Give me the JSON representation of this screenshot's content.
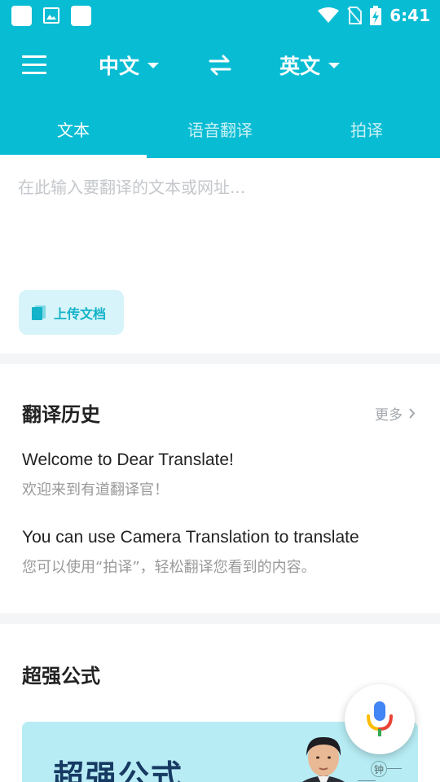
{
  "status_bar": {
    "time": "6:41"
  },
  "app_bar": {
    "source_lang": "中文",
    "target_lang": "英文"
  },
  "tabs": [
    {
      "label": "文本",
      "active": true
    },
    {
      "label": "语音翻译",
      "active": false
    },
    {
      "label": "拍译",
      "active": false
    }
  ],
  "input": {
    "placeholder": "在此输入要翻译的文本或网址...",
    "value": "",
    "upload_label": "上传文档"
  },
  "history": {
    "title": "翻译历史",
    "more_label": "更多",
    "items": [
      {
        "source": "Welcome to Dear Translate!",
        "translation": "欢迎来到有道翻译官！"
      },
      {
        "source": "You can use Camera Translation to translate",
        "translation": "您可以使用“拍译”，轻松翻译您看到的内容。"
      }
    ]
  },
  "formula": {
    "title": "超强公式",
    "banner_text": "超强公式",
    "stamp_char": "钟"
  },
  "colors": {
    "header": "#08bcd3",
    "accent": "#13b3c9",
    "upload_bg": "#d6f4f9",
    "banner_bg": "#b7ecf4"
  },
  "icons": {
    "menu": "menu-icon",
    "swap": "swap-icon",
    "upload": "document-icon",
    "more": "chevron-right-icon",
    "mic": "microphone-icon"
  }
}
